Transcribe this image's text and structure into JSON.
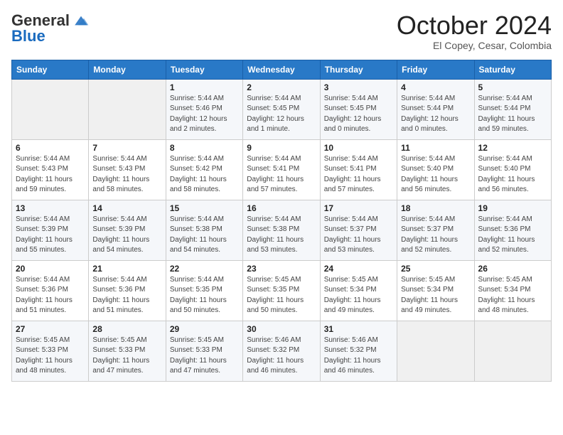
{
  "header": {
    "logo_general": "General",
    "logo_blue": "Blue",
    "month_title": "October 2024",
    "location": "El Copey, Cesar, Colombia"
  },
  "days_of_week": [
    "Sunday",
    "Monday",
    "Tuesday",
    "Wednesday",
    "Thursday",
    "Friday",
    "Saturday"
  ],
  "weeks": [
    [
      {
        "day": "",
        "sunrise": "",
        "sunset": "",
        "daylight": ""
      },
      {
        "day": "",
        "sunrise": "",
        "sunset": "",
        "daylight": ""
      },
      {
        "day": "1",
        "sunrise": "Sunrise: 5:44 AM",
        "sunset": "Sunset: 5:46 PM",
        "daylight": "Daylight: 12 hours and 2 minutes."
      },
      {
        "day": "2",
        "sunrise": "Sunrise: 5:44 AM",
        "sunset": "Sunset: 5:45 PM",
        "daylight": "Daylight: 12 hours and 1 minute."
      },
      {
        "day": "3",
        "sunrise": "Sunrise: 5:44 AM",
        "sunset": "Sunset: 5:45 PM",
        "daylight": "Daylight: 12 hours and 0 minutes."
      },
      {
        "day": "4",
        "sunrise": "Sunrise: 5:44 AM",
        "sunset": "Sunset: 5:44 PM",
        "daylight": "Daylight: 12 hours and 0 minutes."
      },
      {
        "day": "5",
        "sunrise": "Sunrise: 5:44 AM",
        "sunset": "Sunset: 5:44 PM",
        "daylight": "Daylight: 11 hours and 59 minutes."
      }
    ],
    [
      {
        "day": "6",
        "sunrise": "Sunrise: 5:44 AM",
        "sunset": "Sunset: 5:43 PM",
        "daylight": "Daylight: 11 hours and 59 minutes."
      },
      {
        "day": "7",
        "sunrise": "Sunrise: 5:44 AM",
        "sunset": "Sunset: 5:43 PM",
        "daylight": "Daylight: 11 hours and 58 minutes."
      },
      {
        "day": "8",
        "sunrise": "Sunrise: 5:44 AM",
        "sunset": "Sunset: 5:42 PM",
        "daylight": "Daylight: 11 hours and 58 minutes."
      },
      {
        "day": "9",
        "sunrise": "Sunrise: 5:44 AM",
        "sunset": "Sunset: 5:41 PM",
        "daylight": "Daylight: 11 hours and 57 minutes."
      },
      {
        "day": "10",
        "sunrise": "Sunrise: 5:44 AM",
        "sunset": "Sunset: 5:41 PM",
        "daylight": "Daylight: 11 hours and 57 minutes."
      },
      {
        "day": "11",
        "sunrise": "Sunrise: 5:44 AM",
        "sunset": "Sunset: 5:40 PM",
        "daylight": "Daylight: 11 hours and 56 minutes."
      },
      {
        "day": "12",
        "sunrise": "Sunrise: 5:44 AM",
        "sunset": "Sunset: 5:40 PM",
        "daylight": "Daylight: 11 hours and 56 minutes."
      }
    ],
    [
      {
        "day": "13",
        "sunrise": "Sunrise: 5:44 AM",
        "sunset": "Sunset: 5:39 PM",
        "daylight": "Daylight: 11 hours and 55 minutes."
      },
      {
        "day": "14",
        "sunrise": "Sunrise: 5:44 AM",
        "sunset": "Sunset: 5:39 PM",
        "daylight": "Daylight: 11 hours and 54 minutes."
      },
      {
        "day": "15",
        "sunrise": "Sunrise: 5:44 AM",
        "sunset": "Sunset: 5:38 PM",
        "daylight": "Daylight: 11 hours and 54 minutes."
      },
      {
        "day": "16",
        "sunrise": "Sunrise: 5:44 AM",
        "sunset": "Sunset: 5:38 PM",
        "daylight": "Daylight: 11 hours and 53 minutes."
      },
      {
        "day": "17",
        "sunrise": "Sunrise: 5:44 AM",
        "sunset": "Sunset: 5:37 PM",
        "daylight": "Daylight: 11 hours and 53 minutes."
      },
      {
        "day": "18",
        "sunrise": "Sunrise: 5:44 AM",
        "sunset": "Sunset: 5:37 PM",
        "daylight": "Daylight: 11 hours and 52 minutes."
      },
      {
        "day": "19",
        "sunrise": "Sunrise: 5:44 AM",
        "sunset": "Sunset: 5:36 PM",
        "daylight": "Daylight: 11 hours and 52 minutes."
      }
    ],
    [
      {
        "day": "20",
        "sunrise": "Sunrise: 5:44 AM",
        "sunset": "Sunset: 5:36 PM",
        "daylight": "Daylight: 11 hours and 51 minutes."
      },
      {
        "day": "21",
        "sunrise": "Sunrise: 5:44 AM",
        "sunset": "Sunset: 5:36 PM",
        "daylight": "Daylight: 11 hours and 51 minutes."
      },
      {
        "day": "22",
        "sunrise": "Sunrise: 5:44 AM",
        "sunset": "Sunset: 5:35 PM",
        "daylight": "Daylight: 11 hours and 50 minutes."
      },
      {
        "day": "23",
        "sunrise": "Sunrise: 5:45 AM",
        "sunset": "Sunset: 5:35 PM",
        "daylight": "Daylight: 11 hours and 50 minutes."
      },
      {
        "day": "24",
        "sunrise": "Sunrise: 5:45 AM",
        "sunset": "Sunset: 5:34 PM",
        "daylight": "Daylight: 11 hours and 49 minutes."
      },
      {
        "day": "25",
        "sunrise": "Sunrise: 5:45 AM",
        "sunset": "Sunset: 5:34 PM",
        "daylight": "Daylight: 11 hours and 49 minutes."
      },
      {
        "day": "26",
        "sunrise": "Sunrise: 5:45 AM",
        "sunset": "Sunset: 5:34 PM",
        "daylight": "Daylight: 11 hours and 48 minutes."
      }
    ],
    [
      {
        "day": "27",
        "sunrise": "Sunrise: 5:45 AM",
        "sunset": "Sunset: 5:33 PM",
        "daylight": "Daylight: 11 hours and 48 minutes."
      },
      {
        "day": "28",
        "sunrise": "Sunrise: 5:45 AM",
        "sunset": "Sunset: 5:33 PM",
        "daylight": "Daylight: 11 hours and 47 minutes."
      },
      {
        "day": "29",
        "sunrise": "Sunrise: 5:45 AM",
        "sunset": "Sunset: 5:33 PM",
        "daylight": "Daylight: 11 hours and 47 minutes."
      },
      {
        "day": "30",
        "sunrise": "Sunrise: 5:46 AM",
        "sunset": "Sunset: 5:32 PM",
        "daylight": "Daylight: 11 hours and 46 minutes."
      },
      {
        "day": "31",
        "sunrise": "Sunrise: 5:46 AM",
        "sunset": "Sunset: 5:32 PM",
        "daylight": "Daylight: 11 hours and 46 minutes."
      },
      {
        "day": "",
        "sunrise": "",
        "sunset": "",
        "daylight": ""
      },
      {
        "day": "",
        "sunrise": "",
        "sunset": "",
        "daylight": ""
      }
    ]
  ]
}
